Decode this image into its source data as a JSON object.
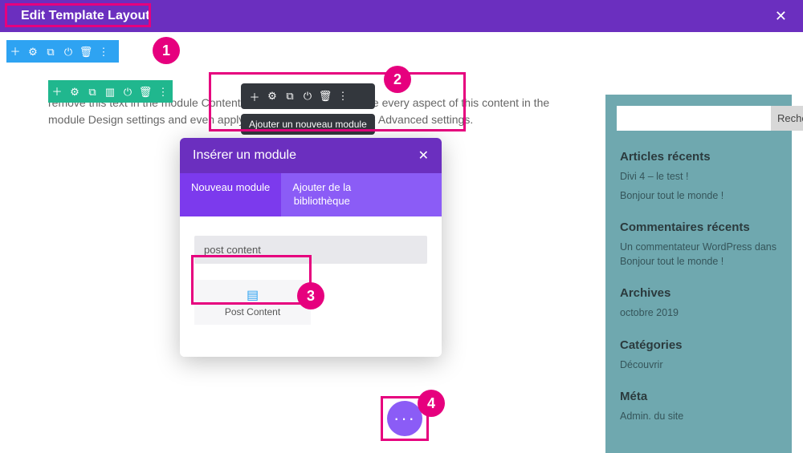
{
  "topbar": {
    "title": "Edit Template Layout"
  },
  "section_toolbar": {
    "icons": [
      "plus",
      "gear",
      "duplicate",
      "power",
      "trash",
      "dots"
    ]
  },
  "row_toolbar": {
    "icons": [
      "plus",
      "gear",
      "duplicate",
      "columns",
      "power",
      "trash",
      "dots"
    ]
  },
  "module_toolbar": {
    "icons": [
      "plus",
      "gear",
      "duplicate",
      "power",
      "trash",
      "dots"
    ],
    "tooltip": "Ajouter un nouveau module"
  },
  "body_text": "remove this text in the module Content settings. You can also style every aspect of this content in the module Design settings and even apply custom text in the module Advanced settings.",
  "modal": {
    "title": "Insérer un module",
    "tabs": {
      "new": "Nouveau module",
      "library": "Ajouter de la\nbibliothèque"
    },
    "search_value": "post content",
    "module_result": {
      "label": "Post Content",
      "icon": "post-content"
    }
  },
  "fab": {
    "label": "···"
  },
  "sidebar": {
    "search_button": "Rechercher",
    "recent_posts": {
      "heading": "Articles récents",
      "items": [
        "Divi 4 – le test !",
        "Bonjour tout le monde !"
      ]
    },
    "recent_comments": {
      "heading": "Commentaires récents",
      "items": [
        "Un commentateur WordPress dans Bonjour tout le monde !"
      ]
    },
    "archives": {
      "heading": "Archives",
      "items": [
        "octobre 2019"
      ]
    },
    "categories": {
      "heading": "Catégories",
      "items": [
        "Découvrir"
      ]
    },
    "meta": {
      "heading": "Méta",
      "items": [
        "Admin. du site"
      ]
    }
  },
  "annotations": {
    "one": "1",
    "two": "2",
    "three": "3",
    "four": "4"
  }
}
